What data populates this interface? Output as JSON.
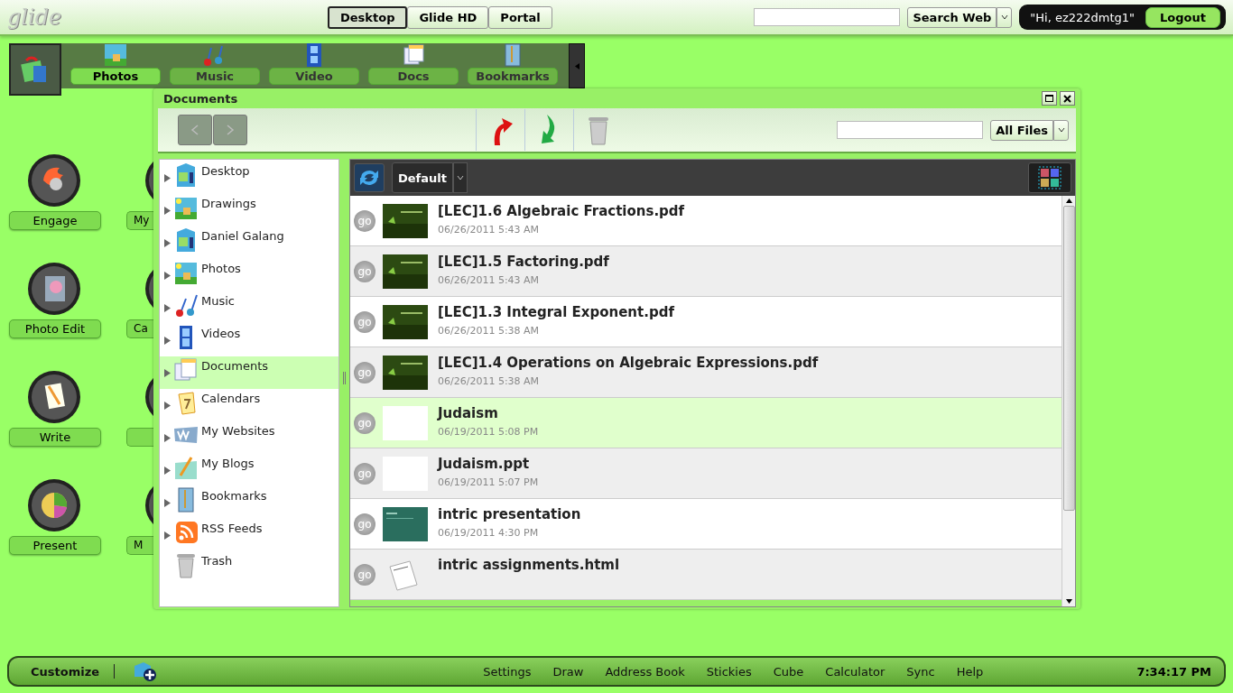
{
  "topbar": {
    "logo": "glide",
    "modes": [
      {
        "label": "Desktop",
        "selected": true
      },
      {
        "label": "Glide HD",
        "selected": false
      },
      {
        "label": "Portal",
        "selected": false
      }
    ],
    "search_button": "Search Web",
    "greeting": "\"Hi, ez222dmtg1\"",
    "logout": "Logout"
  },
  "dock": {
    "items": [
      {
        "label": "Photos",
        "selected": true,
        "kind": "photo"
      },
      {
        "label": "Music",
        "selected": false,
        "kind": "music"
      },
      {
        "label": "Video",
        "selected": false,
        "kind": "video"
      },
      {
        "label": "Docs",
        "selected": false,
        "kind": "docs"
      },
      {
        "label": "Bookmarks",
        "selected": false,
        "kind": "bookmark"
      }
    ]
  },
  "desktop_icons": [
    {
      "label": "Engage",
      "kind": "engage",
      "neighbor": "My"
    },
    {
      "label": "Photo Edit",
      "kind": "photo",
      "neighbor": "Ca"
    },
    {
      "label": "Write",
      "kind": "write"
    },
    {
      "label": "Present",
      "kind": "present",
      "neighbor": "M"
    }
  ],
  "window": {
    "title": "Documents",
    "filter": "All Files",
    "view": "Default",
    "tree": [
      {
        "label": "Desktop",
        "kind": "folder",
        "selected": false,
        "expandable": true
      },
      {
        "label": "Drawings",
        "kind": "photo",
        "selected": false,
        "expandable": true
      },
      {
        "label": "Daniel Galang",
        "kind": "folder",
        "selected": false,
        "expandable": true
      },
      {
        "label": "Photos",
        "kind": "photo",
        "selected": false,
        "expandable": true
      },
      {
        "label": "Music",
        "kind": "music",
        "selected": false,
        "expandable": true
      },
      {
        "label": "Videos",
        "kind": "video",
        "selected": false,
        "expandable": true
      },
      {
        "label": "Documents",
        "kind": "docs",
        "selected": true,
        "expandable": true
      },
      {
        "label": "Calendars",
        "kind": "calendar",
        "selected": false,
        "expandable": true
      },
      {
        "label": "My Websites",
        "kind": "web",
        "selected": false,
        "expandable": true
      },
      {
        "label": "My Blogs",
        "kind": "blog",
        "selected": false,
        "expandable": true
      },
      {
        "label": "Bookmarks",
        "kind": "bookmark",
        "selected": false,
        "expandable": true
      },
      {
        "label": "RSS Feeds",
        "kind": "rss",
        "selected": false,
        "expandable": true
      },
      {
        "label": "Trash",
        "kind": "trash",
        "selected": false,
        "expandable": false
      }
    ],
    "files": [
      {
        "go": "go",
        "name": "[LEC]1.6 Algebraic Fractions.pdf",
        "date": "06/26/2011 5:43 AM",
        "kind": "green",
        "selected": false
      },
      {
        "go": "go",
        "name": "[LEC]1.5 Factoring.pdf",
        "date": "06/26/2011 5:43 AM",
        "kind": "green",
        "selected": false
      },
      {
        "go": "go",
        "name": "[LEC]1.3 Integral Exponent.pdf",
        "date": "06/26/2011 5:38 AM",
        "kind": "green",
        "selected": false
      },
      {
        "go": "go",
        "name": "[LEC]1.4 Operations on Algebraic Expressions.pdf",
        "date": "06/26/2011 5:38 AM",
        "kind": "green",
        "selected": false
      },
      {
        "go": "go",
        "name": "Judaism",
        "date": "06/19/2011 5:08 PM",
        "kind": "blank",
        "selected": true
      },
      {
        "go": "go",
        "name": "Judaism.ppt",
        "date": "06/19/2011 5:07 PM",
        "kind": "blank",
        "selected": false
      },
      {
        "go": "go",
        "name": "intric presentation",
        "date": "06/19/2011 4:30 PM",
        "kind": "teal",
        "selected": false
      },
      {
        "go": "go",
        "name": "intric assignments.html",
        "kind": "doc",
        "selected": false
      }
    ]
  },
  "taskbar": {
    "customize": "Customize",
    "items": [
      "Settings",
      "Draw",
      "Address Book",
      "Stickies",
      "Cube",
      "Calculator",
      "Sync",
      "Help"
    ],
    "clock": "7:34:17 PM"
  }
}
